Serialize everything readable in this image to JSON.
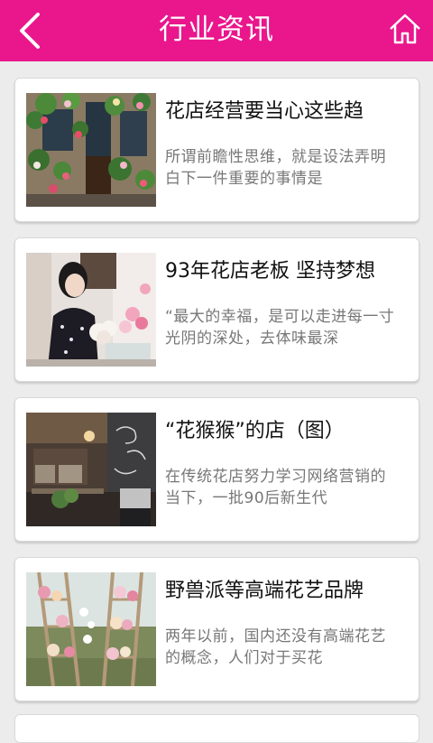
{
  "header": {
    "title": "行业资讯",
    "back_icon": "chevron-left-icon",
    "home_icon": "home-icon",
    "color": "#e9168c"
  },
  "articles": [
    {
      "title": "花店经营要当心这些趋",
      "summary": "所谓前瞻性思维，就是设法弄明白下一件重要的事情是"
    },
    {
      "title": "93年花店老板 坚持梦想",
      "summary": "“最大的幸福，是可以走进每一寸光阴的深处，去体味最深"
    },
    {
      "title": "“花猴猴”的店（图）",
      "summary": "在传统花店努力学习网络营销的当下，一批90后新生代"
    },
    {
      "title": "野兽派等高端花艺品牌",
      "summary": "两年以前，国内还没有高端花艺的概念，人们对于买花"
    }
  ]
}
